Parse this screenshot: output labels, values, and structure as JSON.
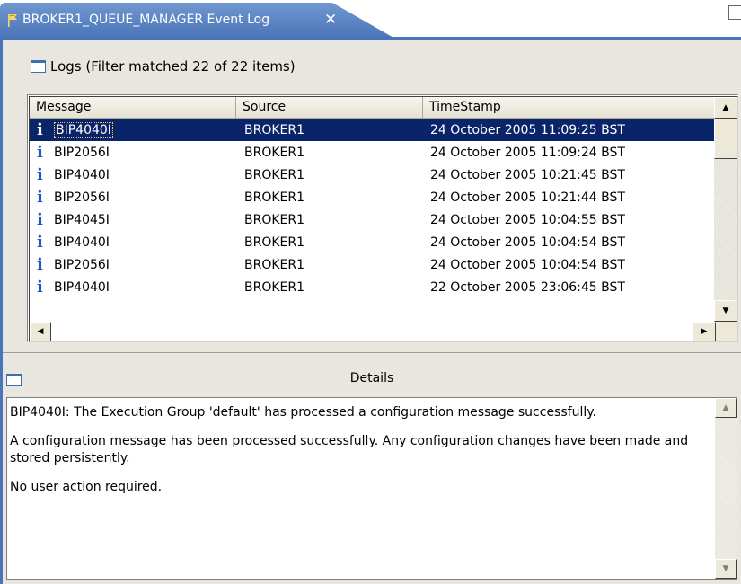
{
  "tab": {
    "title": "BROKER1_QUEUE_MANAGER Event Log",
    "close_glyph": "✕",
    "icon": "flag-icon"
  },
  "logs": {
    "header": "Logs (Filter matched 22 of 22 items)",
    "icon": "log-view-icon",
    "columns": [
      "Message",
      "Source",
      "TimeStamp"
    ],
    "rows": [
      {
        "message": "BIP4040I",
        "source": "BROKER1",
        "timestamp": "24 October 2005 11:09:25 BST",
        "selected": true
      },
      {
        "message": "BIP2056I",
        "source": "BROKER1",
        "timestamp": "24 October 2005 11:09:24 BST"
      },
      {
        "message": "BIP4040I",
        "source": "BROKER1",
        "timestamp": "24 October 2005 10:21:45 BST"
      },
      {
        "message": "BIP2056I",
        "source": "BROKER1",
        "timestamp": "24 October 2005 10:21:44 BST"
      },
      {
        "message": "BIP4045I",
        "source": "BROKER1",
        "timestamp": "24 October 2005 10:04:55 BST"
      },
      {
        "message": "BIP4040I",
        "source": "BROKER1",
        "timestamp": "24 October 2005 10:04:54 BST"
      },
      {
        "message": "BIP2056I",
        "source": "BROKER1",
        "timestamp": "24 October 2005 10:04:54 BST"
      },
      {
        "message": "BIP4040I",
        "source": "BROKER1",
        "timestamp": "22 October 2005 23:06:45 BST"
      }
    ],
    "row_icon": "info-icon",
    "info_glyph": "i"
  },
  "details": {
    "title": "Details",
    "icon": "details-view-icon",
    "paragraphs": [
      "BIP4040I: The Execution Group 'default' has processed a configuration message successfully.",
      "A configuration message has been processed successfully. Any configuration changes have been made and stored persistently.",
      "No user action required."
    ]
  },
  "colors": {
    "tab_blue": "#4a74b8",
    "selection": "#0a246a",
    "panel_bg": "#e8e6de"
  }
}
